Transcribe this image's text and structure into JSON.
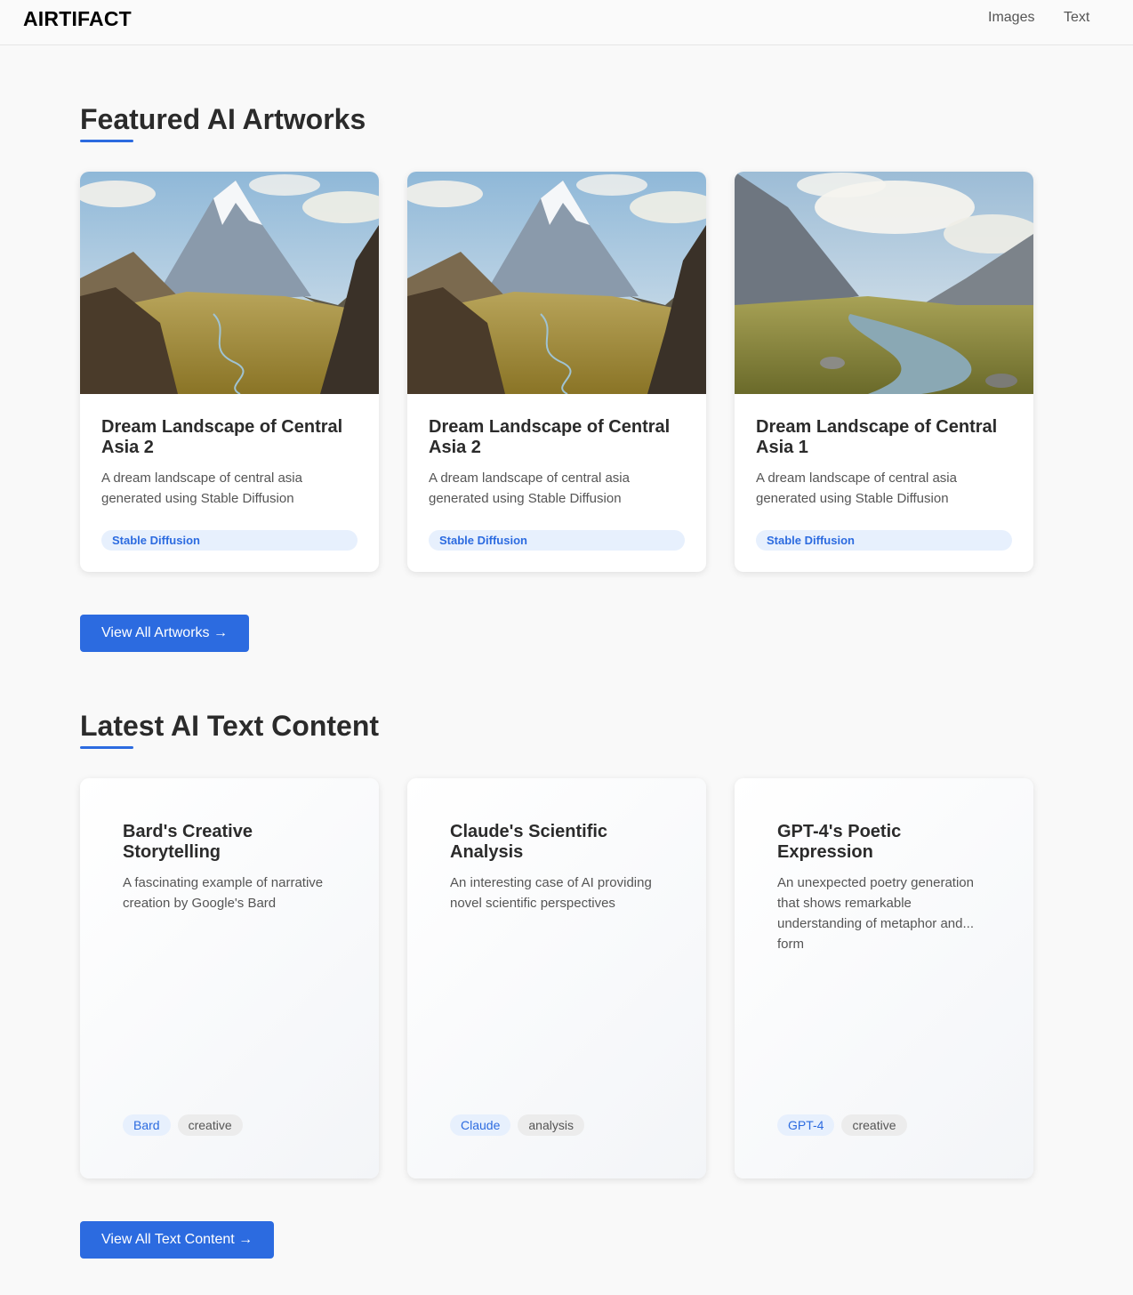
{
  "header": {
    "logo": "AIRTIFACT",
    "nav": [
      "Images",
      "Text"
    ]
  },
  "featured": {
    "title": "Featured AI Artworks",
    "cards": [
      {
        "title": "Dream Landscape of Central Asia 2",
        "description": "A dream landscape of central asia generated using Stable Diffusion",
        "tag": "Stable Diffusion",
        "image": "mountain-valley"
      },
      {
        "title": "Dream Landscape of Central Asia 2",
        "description": "A dream landscape of central asia generated using Stable Diffusion",
        "tag": "Stable Diffusion",
        "image": "mountain-valley"
      },
      {
        "title": "Dream Landscape of Central Asia 1",
        "description": "A dream landscape of central asia generated using Stable Diffusion",
        "tag": "Stable Diffusion",
        "image": "river-valley"
      }
    ],
    "button": "View All Artworks →"
  },
  "latest": {
    "title": "Latest AI Text Content",
    "cards": [
      {
        "title": "Bard's Creative Storytelling",
        "description": "A fascinating example of narrative creation by Google's Bard",
        "model": "Bard",
        "category": "creative"
      },
      {
        "title": "Claude's Scientific Analysis",
        "description": "An interesting case of AI providing novel scientific perspectives",
        "model": "Claude",
        "category": "analysis"
      },
      {
        "title": "GPT-4's Poetic Expression",
        "description": "An unexpected poetry generation that shows remarkable understanding of metaphor and... form",
        "model": "GPT-4",
        "category": "creative"
      }
    ],
    "button": "View All Text Content →"
  },
  "colors": {
    "accent": "#2c6be0",
    "tag_bg": "#e7f0fd",
    "pill_grey": "#ececec"
  }
}
